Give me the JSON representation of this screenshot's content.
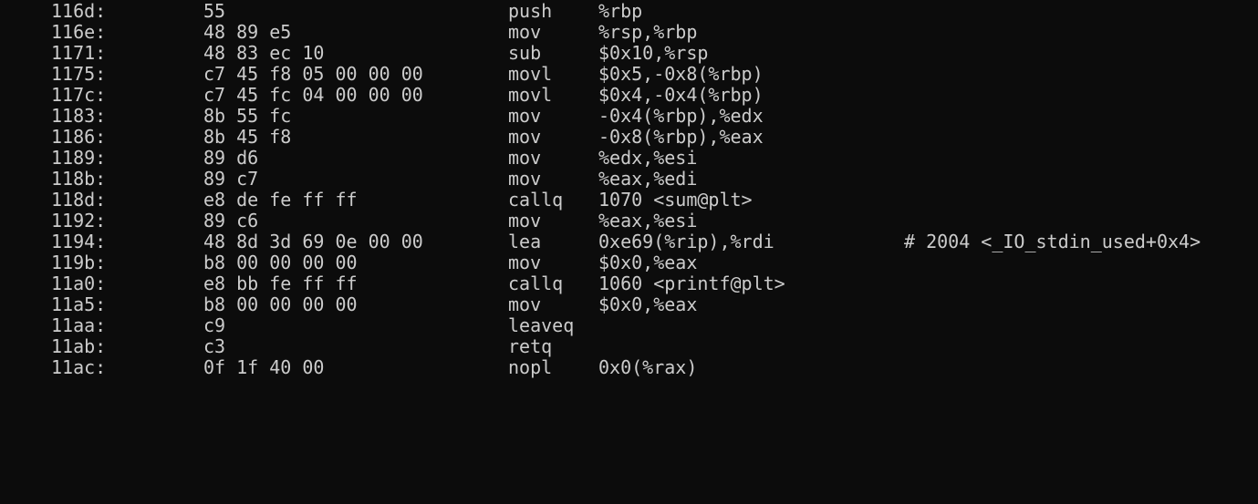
{
  "terminal": {
    "foreground": "#cccccc",
    "background": "#0c0c0c",
    "lines": [
      {
        "addr": "116d:",
        "bytes": "55",
        "mnem": "push",
        "ops": "%rbp",
        "cmt": ""
      },
      {
        "addr": "116e:",
        "bytes": "48 89 e5",
        "mnem": "mov",
        "ops": "%rsp,%rbp",
        "cmt": ""
      },
      {
        "addr": "1171:",
        "bytes": "48 83 ec 10",
        "mnem": "sub",
        "ops": "$0x10,%rsp",
        "cmt": ""
      },
      {
        "addr": "1175:",
        "bytes": "c7 45 f8 05 00 00 00",
        "mnem": "movl",
        "ops": "$0x5,-0x8(%rbp)",
        "cmt": ""
      },
      {
        "addr": "117c:",
        "bytes": "c7 45 fc 04 00 00 00",
        "mnem": "movl",
        "ops": "$0x4,-0x4(%rbp)",
        "cmt": ""
      },
      {
        "addr": "1183:",
        "bytes": "8b 55 fc",
        "mnem": "mov",
        "ops": "-0x4(%rbp),%edx",
        "cmt": ""
      },
      {
        "addr": "1186:",
        "bytes": "8b 45 f8",
        "mnem": "mov",
        "ops": "-0x8(%rbp),%eax",
        "cmt": ""
      },
      {
        "addr": "1189:",
        "bytes": "89 d6",
        "mnem": "mov",
        "ops": "%edx,%esi",
        "cmt": ""
      },
      {
        "addr": "118b:",
        "bytes": "89 c7",
        "mnem": "mov",
        "ops": "%eax,%edi",
        "cmt": ""
      },
      {
        "addr": "118d:",
        "bytes": "e8 de fe ff ff",
        "mnem": "callq",
        "ops": "1070 <sum@plt>",
        "cmt": ""
      },
      {
        "addr": "1192:",
        "bytes": "89 c6",
        "mnem": "mov",
        "ops": "%eax,%esi",
        "cmt": ""
      },
      {
        "addr": "1194:",
        "bytes": "48 8d 3d 69 0e 00 00",
        "mnem": "lea",
        "ops": "0xe69(%rip),%rdi",
        "cmt": "# 2004 <_IO_stdin_used+0x4>"
      },
      {
        "addr": "119b:",
        "bytes": "b8 00 00 00 00",
        "mnem": "mov",
        "ops": "$0x0,%eax",
        "cmt": ""
      },
      {
        "addr": "11a0:",
        "bytes": "e8 bb fe ff ff",
        "mnem": "callq",
        "ops": "1060 <printf@plt>",
        "cmt": ""
      },
      {
        "addr": "11a5:",
        "bytes": "b8 00 00 00 00",
        "mnem": "mov",
        "ops": "$0x0,%eax",
        "cmt": ""
      },
      {
        "addr": "11aa:",
        "bytes": "c9",
        "mnem": "leaveq",
        "ops": "",
        "cmt": ""
      },
      {
        "addr": "11ab:",
        "bytes": "c3",
        "mnem": "retq",
        "ops": "",
        "cmt": ""
      },
      {
        "addr": "11ac:",
        "bytes": "0f 1f 40 00",
        "mnem": "nopl",
        "ops": "0x0(%rax)",
        "cmt": ""
      }
    ]
  }
}
